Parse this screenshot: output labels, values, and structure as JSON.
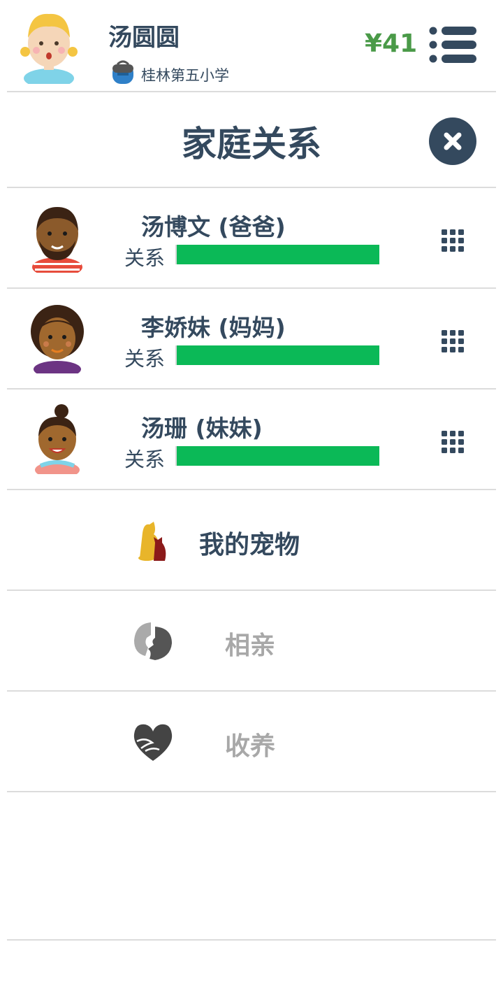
{
  "header": {
    "user_name": "汤圆圆",
    "school": "桂林第五小学",
    "money": "¥41",
    "money_color": "#4a9a48",
    "menu_icon": "list-menu-icon"
  },
  "modal": {
    "title": "家庭关系",
    "close_icon": "close-icon"
  },
  "family": [
    {
      "name": "汤博文 (爸爸)",
      "relation_label": "关系",
      "relation_level": 1.0,
      "avatar": "bearded-man-avatar-icon"
    },
    {
      "name": "李娇妹 (妈妈)",
      "relation_label": "关系",
      "relation_level": 1.0,
      "avatar": "curly-hair-woman-avatar-icon"
    },
    {
      "name": "汤珊 (妹妹)",
      "relation_label": "关系",
      "relation_level": 1.0,
      "avatar": "bun-hair-girl-avatar-icon"
    }
  ],
  "menu": [
    {
      "label": "我的宠物",
      "enabled": true,
      "icon": "dog-cat-pet-icon"
    },
    {
      "label": "相亲",
      "enabled": false,
      "icon": "kissing-couple-icon"
    },
    {
      "label": "收养",
      "enabled": false,
      "icon": "heart-hands-icon"
    }
  ],
  "colors": {
    "primary_text": "#34495e",
    "relation_bar": "#0bb957",
    "disabled_text": "#a8a8a8",
    "divider": "#dcdcdc"
  }
}
